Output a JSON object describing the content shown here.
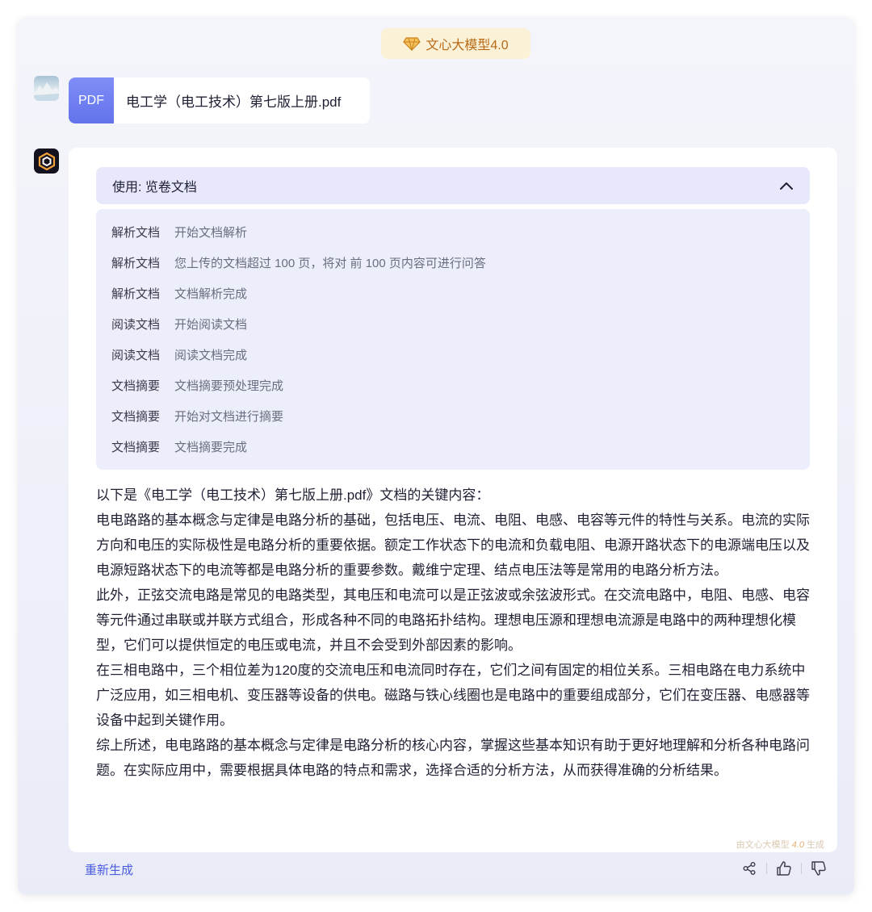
{
  "model_badge": {
    "icon": "gem-icon",
    "label": "文心大模型4.0"
  },
  "user_message": {
    "file": {
      "type_label": "PDF",
      "name": "电工学（电工技术）第七版上册.pdf"
    }
  },
  "tool_use": {
    "title": "使用: 览卷文档",
    "toggle_icon": "chevron-up-icon",
    "steps": [
      {
        "name": "解析文档",
        "detail": "开始文档解析"
      },
      {
        "name": "解析文档",
        "detail": "您上传的文档超过 100 页，将对 前 100 页内容可进行问答"
      },
      {
        "name": "解析文档",
        "detail": "文档解析完成"
      },
      {
        "name": "阅读文档",
        "detail": "开始阅读文档"
      },
      {
        "name": "阅读文档",
        "detail": "阅读文档完成"
      },
      {
        "name": "文档摘要",
        "detail": "文档摘要预处理完成"
      },
      {
        "name": "文档摘要",
        "detail": "开始对文档进行摘要"
      },
      {
        "name": "文档摘要",
        "detail": "文档摘要完成"
      }
    ]
  },
  "answer": {
    "paragraphs": [
      "以下是《电工学（电工技术）第七版上册.pdf》文档的关键内容：",
      "电电路路的基本概念与定律是电路分析的基础，包括电压、电流、电阻、电感、电容等元件的特性与关系。电流的实际方向和电压的实际极性是电路分析的重要依据。额定工作状态下的电流和负载电阻、电源开路状态下的电源端电压以及电源短路状态下的电流等都是电路分析的重要参数。戴维宁定理、结点电压法等是常用的电路分析方法。",
      "此外，正弦交流电路是常见的电路类型，其电压和电流可以是正弦波或余弦波形式。在交流电路中，电阻、电感、电容等元件通过串联或并联方式组合，形成各种不同的电路拓扑结构。理想电压源和理想电流源是电路中的两种理想化模型，它们可以提供恒定的电压或电流，并且不会受到外部因素的影响。",
      "在三相电路中，三个相位差为120度的交流电压和电流同时存在，它们之间有固定的相位关系。三相电路在电力系统中广泛应用，如三相电机、变压器等设备的供电。磁路与铁心线圈也是电路中的重要组成部分，它们在变压器、电感器等设备中起到关键作用。",
      "综上所述，电电路路的基本概念与定律是电路分析的核心内容，掌握这些基本知识有助于更好地理解和分析各种电路问题。在实际应用中，需要根据具体电路的特点和需求，选择合适的分析方法，从而获得准确的分析结果。"
    ],
    "footnote_prefix": "由文心大模型",
    "footnote_version": "4.0",
    "footnote_suffix": "生成"
  },
  "footer": {
    "regenerate_label": "重新生成",
    "icons": [
      "share-icon",
      "thumbs-up-icon",
      "thumbs-down-icon"
    ]
  }
}
